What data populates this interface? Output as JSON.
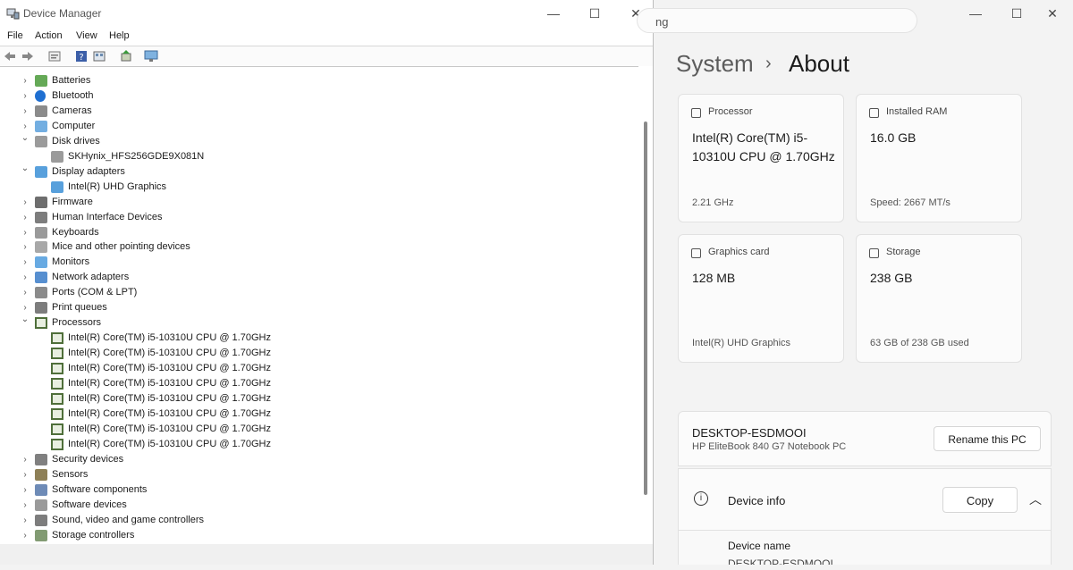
{
  "device_manager": {
    "title": "Device Manager",
    "menu": [
      "File",
      "Action",
      "View",
      "Help"
    ],
    "controls": {
      "minimize": "—",
      "maximize": "☐",
      "close": "✕"
    },
    "tree": [
      {
        "label": "Batteries",
        "level": 0,
        "state": "collapsed",
        "icon": "battery-icon"
      },
      {
        "label": "Bluetooth",
        "level": 0,
        "state": "collapsed",
        "icon": "bluetooth-icon"
      },
      {
        "label": "Cameras",
        "level": 0,
        "state": "collapsed",
        "icon": "camera-icon"
      },
      {
        "label": "Computer",
        "level": 0,
        "state": "collapsed",
        "icon": "computer-icon"
      },
      {
        "label": "Disk drives",
        "level": 0,
        "state": "expanded",
        "icon": "disk-drive-icon"
      },
      {
        "label": "SKHynix_HFS256GDE9X081N",
        "level": 1,
        "state": "leaf",
        "icon": "disk-drive-icon"
      },
      {
        "label": "Display adapters",
        "level": 0,
        "state": "expanded",
        "icon": "display-adapter-icon"
      },
      {
        "label": "Intel(R) UHD Graphics",
        "level": 1,
        "state": "leaf",
        "icon": "display-adapter-icon"
      },
      {
        "label": "Firmware",
        "level": 0,
        "state": "collapsed",
        "icon": "firmware-icon"
      },
      {
        "label": "Human Interface Devices",
        "level": 0,
        "state": "collapsed",
        "icon": "hid-icon"
      },
      {
        "label": "Keyboards",
        "level": 0,
        "state": "collapsed",
        "icon": "keyboard-icon"
      },
      {
        "label": "Mice and other pointing devices",
        "level": 0,
        "state": "collapsed",
        "icon": "mouse-icon"
      },
      {
        "label": "Monitors",
        "level": 0,
        "state": "collapsed",
        "icon": "monitor-icon"
      },
      {
        "label": "Network adapters",
        "level": 0,
        "state": "collapsed",
        "icon": "network-icon"
      },
      {
        "label": "Ports (COM & LPT)",
        "level": 0,
        "state": "collapsed",
        "icon": "port-icon"
      },
      {
        "label": "Print queues",
        "level": 0,
        "state": "collapsed",
        "icon": "printer-icon"
      },
      {
        "label": "Processors",
        "level": 0,
        "state": "expanded",
        "icon": "processor-icon"
      },
      {
        "label": "Intel(R) Core(TM) i5-10310U CPU @ 1.70GHz",
        "level": 1,
        "state": "leaf",
        "icon": "processor-icon"
      },
      {
        "label": "Intel(R) Core(TM) i5-10310U CPU @ 1.70GHz",
        "level": 1,
        "state": "leaf",
        "icon": "processor-icon"
      },
      {
        "label": "Intel(R) Core(TM) i5-10310U CPU @ 1.70GHz",
        "level": 1,
        "state": "leaf",
        "icon": "processor-icon"
      },
      {
        "label": "Intel(R) Core(TM) i5-10310U CPU @ 1.70GHz",
        "level": 1,
        "state": "leaf",
        "icon": "processor-icon"
      },
      {
        "label": "Intel(R) Core(TM) i5-10310U CPU @ 1.70GHz",
        "level": 1,
        "state": "leaf",
        "icon": "processor-icon"
      },
      {
        "label": "Intel(R) Core(TM) i5-10310U CPU @ 1.70GHz",
        "level": 1,
        "state": "leaf",
        "icon": "processor-icon"
      },
      {
        "label": "Intel(R) Core(TM) i5-10310U CPU @ 1.70GHz",
        "level": 1,
        "state": "leaf",
        "icon": "processor-icon"
      },
      {
        "label": "Intel(R) Core(TM) i5-10310U CPU @ 1.70GHz",
        "level": 1,
        "state": "leaf",
        "icon": "processor-icon"
      },
      {
        "label": "Security devices",
        "level": 0,
        "state": "collapsed",
        "icon": "security-icon"
      },
      {
        "label": "Sensors",
        "level": 0,
        "state": "collapsed",
        "icon": "sensor-icon"
      },
      {
        "label": "Software components",
        "level": 0,
        "state": "collapsed",
        "icon": "software-component-icon"
      },
      {
        "label": "Software devices",
        "level": 0,
        "state": "collapsed",
        "icon": "software-device-icon"
      },
      {
        "label": "Sound, video and game controllers",
        "level": 0,
        "state": "collapsed",
        "icon": "sound-icon"
      },
      {
        "label": "Storage controllers",
        "level": 0,
        "state": "collapsed",
        "icon": "storage-controller-icon"
      }
    ]
  },
  "settings": {
    "search_partial": "ng",
    "controls": {
      "minimize": "—",
      "maximize": "☐",
      "close": "✕"
    },
    "breadcrumb": {
      "parent": "System",
      "separator": "›",
      "current": "About"
    },
    "cards": [
      {
        "label": "Processor",
        "value": "Intel(R) Core(TM) i5-10310U CPU @ 1.70GHz",
        "sub": "2.21 GHz",
        "icon": "processor-icon"
      },
      {
        "label": "Installed RAM",
        "value": "16.0 GB",
        "sub": "Speed: 2667 MT/s",
        "icon": "ram-icon"
      },
      {
        "label": "Graphics card",
        "value": "128 MB",
        "sub": "Intel(R) UHD Graphics",
        "icon": "graphics-card-icon"
      },
      {
        "label": "Storage",
        "value": "238 GB",
        "sub": "63 GB of 238 GB used",
        "icon": "storage-icon"
      }
    ],
    "pc": {
      "name": "DESKTOP-ESDMOOI",
      "model": "HP EliteBook 840 G7 Notebook PC",
      "rename_label": "Rename this PC"
    },
    "device_info": {
      "title": "Device info",
      "copy_label": "Copy",
      "chevron": "︿",
      "info_glyph": "i",
      "device_name_label": "Device name",
      "device_name_value": "DESKTOP-ESDMOOI"
    }
  }
}
